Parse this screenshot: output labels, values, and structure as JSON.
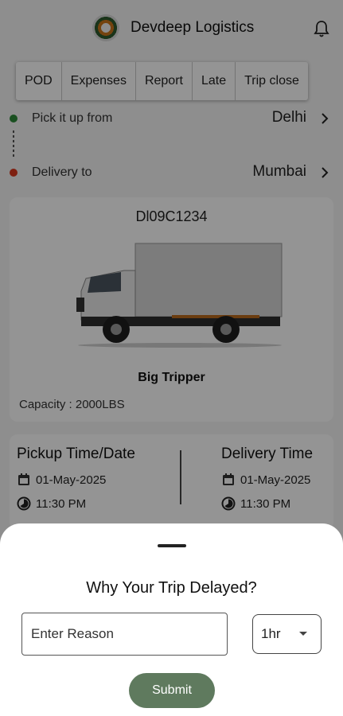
{
  "app": {
    "title": "Devdeep Logistics"
  },
  "tabs": [
    "POD",
    "Expenses",
    "Report",
    "Late",
    "Trip close"
  ],
  "route": {
    "pickup": {
      "label": "Pick it up from",
      "city": "Delhi",
      "dot_color": "#2e8b3a"
    },
    "delivery": {
      "label": "Delivery to",
      "city": "Mumbai",
      "dot_color": "#d9381e"
    }
  },
  "vehicle": {
    "plate": "Dl09C1234",
    "name": "Big Tripper",
    "capacity": "Capacity : 2000LBS"
  },
  "times": {
    "pickup": {
      "title": "Pickup Time/Date",
      "date": "01-May-2025",
      "time": "11:30 PM"
    },
    "delivery": {
      "title": "Delivery Time",
      "date": "01-May-2025",
      "time": "11:30 PM"
    }
  },
  "sheet": {
    "title": "Why Your Trip Delayed?",
    "reason_placeholder": "Enter Reason",
    "duration_value": "1hr",
    "submit_label": "Submit"
  },
  "colors": {
    "accent": "#5f7a5e",
    "scrim": "rgba(0,0,0,0.42)"
  },
  "icons": [
    "app-logo-icon",
    "bell-icon",
    "chevron-right-icon",
    "calendar-icon",
    "clock-icon",
    "dropdown-caret-icon"
  ]
}
